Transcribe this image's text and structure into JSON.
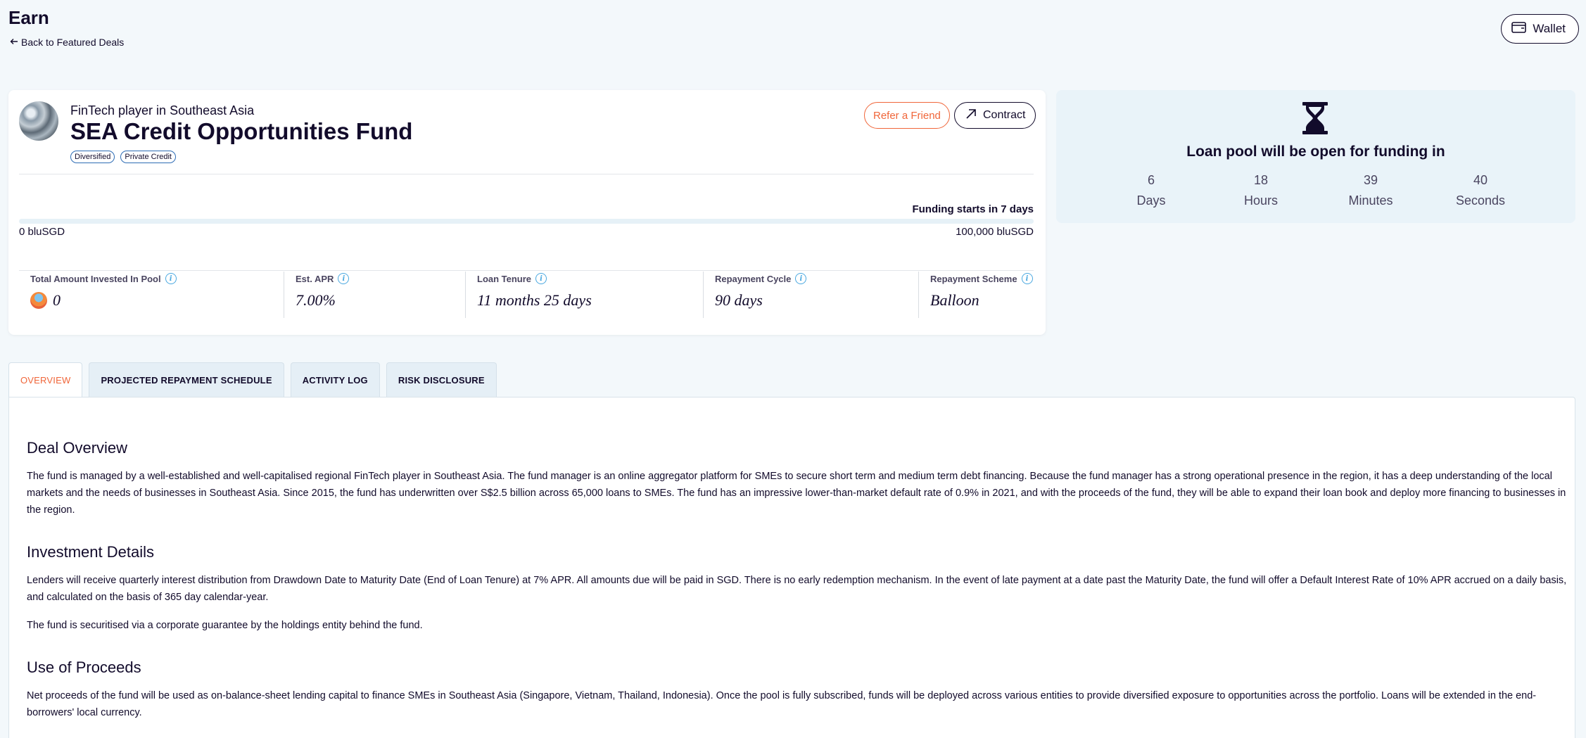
{
  "header": {
    "title": "Earn",
    "back_link": "Back to Featured Deals",
    "wallet_label": "Wallet"
  },
  "deal": {
    "subtitle": "FinTech player in Southeast Asia",
    "title": "SEA Credit Opportunities Fund",
    "tags": [
      "Diversified",
      "Private Credit"
    ],
    "refer_label": "Refer a Friend",
    "contract_label": "Contract",
    "funding_status": "Funding starts in 7 days",
    "progress": {
      "fraction": 0,
      "min_label": "0 bluSGD",
      "max_label": "100,000 bluSGD"
    },
    "stats": [
      {
        "label": "Total Amount Invested In Pool",
        "value": "0"
      },
      {
        "label": "Est. APR",
        "value": "7.00%"
      },
      {
        "label": "Loan Tenure",
        "value": "11 months 25 days"
      },
      {
        "label": "Repayment Cycle",
        "value": "90 days"
      },
      {
        "label": "Repayment Scheme",
        "value": "Balloon"
      }
    ]
  },
  "countdown": {
    "title": "Loan pool will be open for funding in",
    "units": [
      {
        "value": "6",
        "label": "Days"
      },
      {
        "value": "18",
        "label": "Hours"
      },
      {
        "value": "39",
        "label": "Minutes"
      },
      {
        "value": "40",
        "label": "Seconds"
      }
    ]
  },
  "tabs": [
    {
      "label": "OVERVIEW",
      "active": true
    },
    {
      "label": "PROJECTED REPAYMENT SCHEDULE",
      "active": false
    },
    {
      "label": "ACTIVITY LOG",
      "active": false
    },
    {
      "label": "RISK DISCLOSURE",
      "active": false
    }
  ],
  "overview": {
    "deal_overview_heading": "Deal Overview",
    "deal_overview_text": "The fund is managed by a well-established and well-capitalised regional FinTech player in Southeast Asia. The fund manager is an online aggregator platform for SMEs to secure short term and medium term debt financing. Because the fund manager has a strong operational presence in the region, it has a deep understanding of the local markets and the needs of businesses in Southeast Asia. Since 2015, the fund has underwritten over S$2.5 billion across 65,000 loans to SMEs. The fund has an impressive lower-than-market default rate of 0.9% in 2021, and with the proceeds of the fund, they will be able to expand their loan book and deploy more financing to businesses in the region.",
    "investment_heading": "Investment Details",
    "investment_text_1": "Lenders will receive quarterly interest distribution from Drawdown Date to Maturity Date (End of Loan Tenure) at 7% APR. All amounts due will be paid in SGD. There is no early redemption mechanism. In the event of late payment at a date past the Maturity Date, the fund will offer a Default Interest Rate of 10% APR accrued on a daily basis, and calculated on the basis of 365 day calendar-year.",
    "investment_text_2": "The fund is securitised via a corporate guarantee by the holdings entity behind the fund.",
    "proceeds_heading": "Use of Proceeds",
    "proceeds_text": "Net proceeds of the fund will be used as on-balance-sheet lending capital to finance SMEs in Southeast Asia (Singapore, Vietnam, Thailand, Indonesia). Once the pool is fully subscribed, funds will be deployed across various entities to provide diversified exposure to opportunities across the portfolio. Loans will be extended in the end-borrowers' local currency."
  },
  "colors": {
    "accent": "#f0663a",
    "text": "#120b2b",
    "info": "#4aa8e0",
    "countdown_bg": "#e9f3f9"
  }
}
